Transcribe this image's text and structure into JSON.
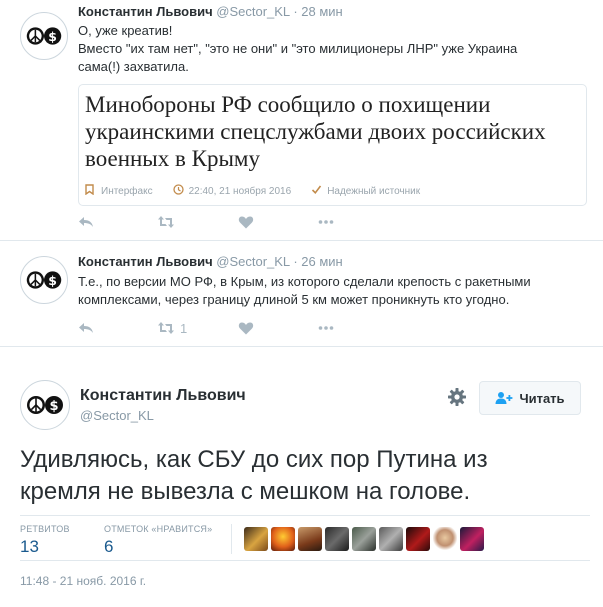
{
  "tweets": [
    {
      "name": "Константин Львович",
      "handle": "@Sector_KL",
      "dot": "·",
      "time": "28 мин",
      "lines": [
        "О, уже креатив!",
        "Вместо \"их там нет\", \"это не они\" и \"это милиционеры ЛНР\" уже Украина",
        "сама(!) захватила."
      ],
      "card": {
        "headline": "Минобороны РФ сообщило о похищении украинскими спецслужбами двоих российских военных в Крыму",
        "source": "Интерфакс",
        "datetime": "22:40, 21 ноября 2016",
        "badge": "Надежный источник"
      },
      "retweets": "",
      "likes": ""
    },
    {
      "name": "Константин Львович",
      "handle": "@Sector_KL",
      "dot": "·",
      "time": "26 мин",
      "lines": [
        "Т.е., по версии МО РФ, в Крым, из которого сделали крепость с ракетными",
        "комплексами, через границу длиной 5 км может проникнуть кто угодно."
      ],
      "retweets": "1",
      "likes": ""
    }
  ],
  "main": {
    "name": "Константин Львович",
    "handle": "@Sector_KL",
    "follow_label": "Читать",
    "text_line1": "Удивляюсь, как СБУ до сих пор Путина из",
    "text_line2": "кремля не вывезла с мешком на голове.",
    "retweets_label": "РЕТВИТОВ",
    "retweets_value": "13",
    "likes_label": "ОТМЕТОК «НРАВИТСЯ»",
    "likes_value": "6",
    "date": "11:48 - 21 нояб. 2016 г."
  },
  "icons": {
    "reply": "reply-icon",
    "retweet": "retweet-icon",
    "like": "heart-icon",
    "more": "more-icon",
    "settings": "gear-icon",
    "follow": "add-user-icon"
  },
  "colors": {
    "link_blue": "#1a5a8e",
    "muted": "#8899a6",
    "icon_gray": "#aab8c2"
  }
}
